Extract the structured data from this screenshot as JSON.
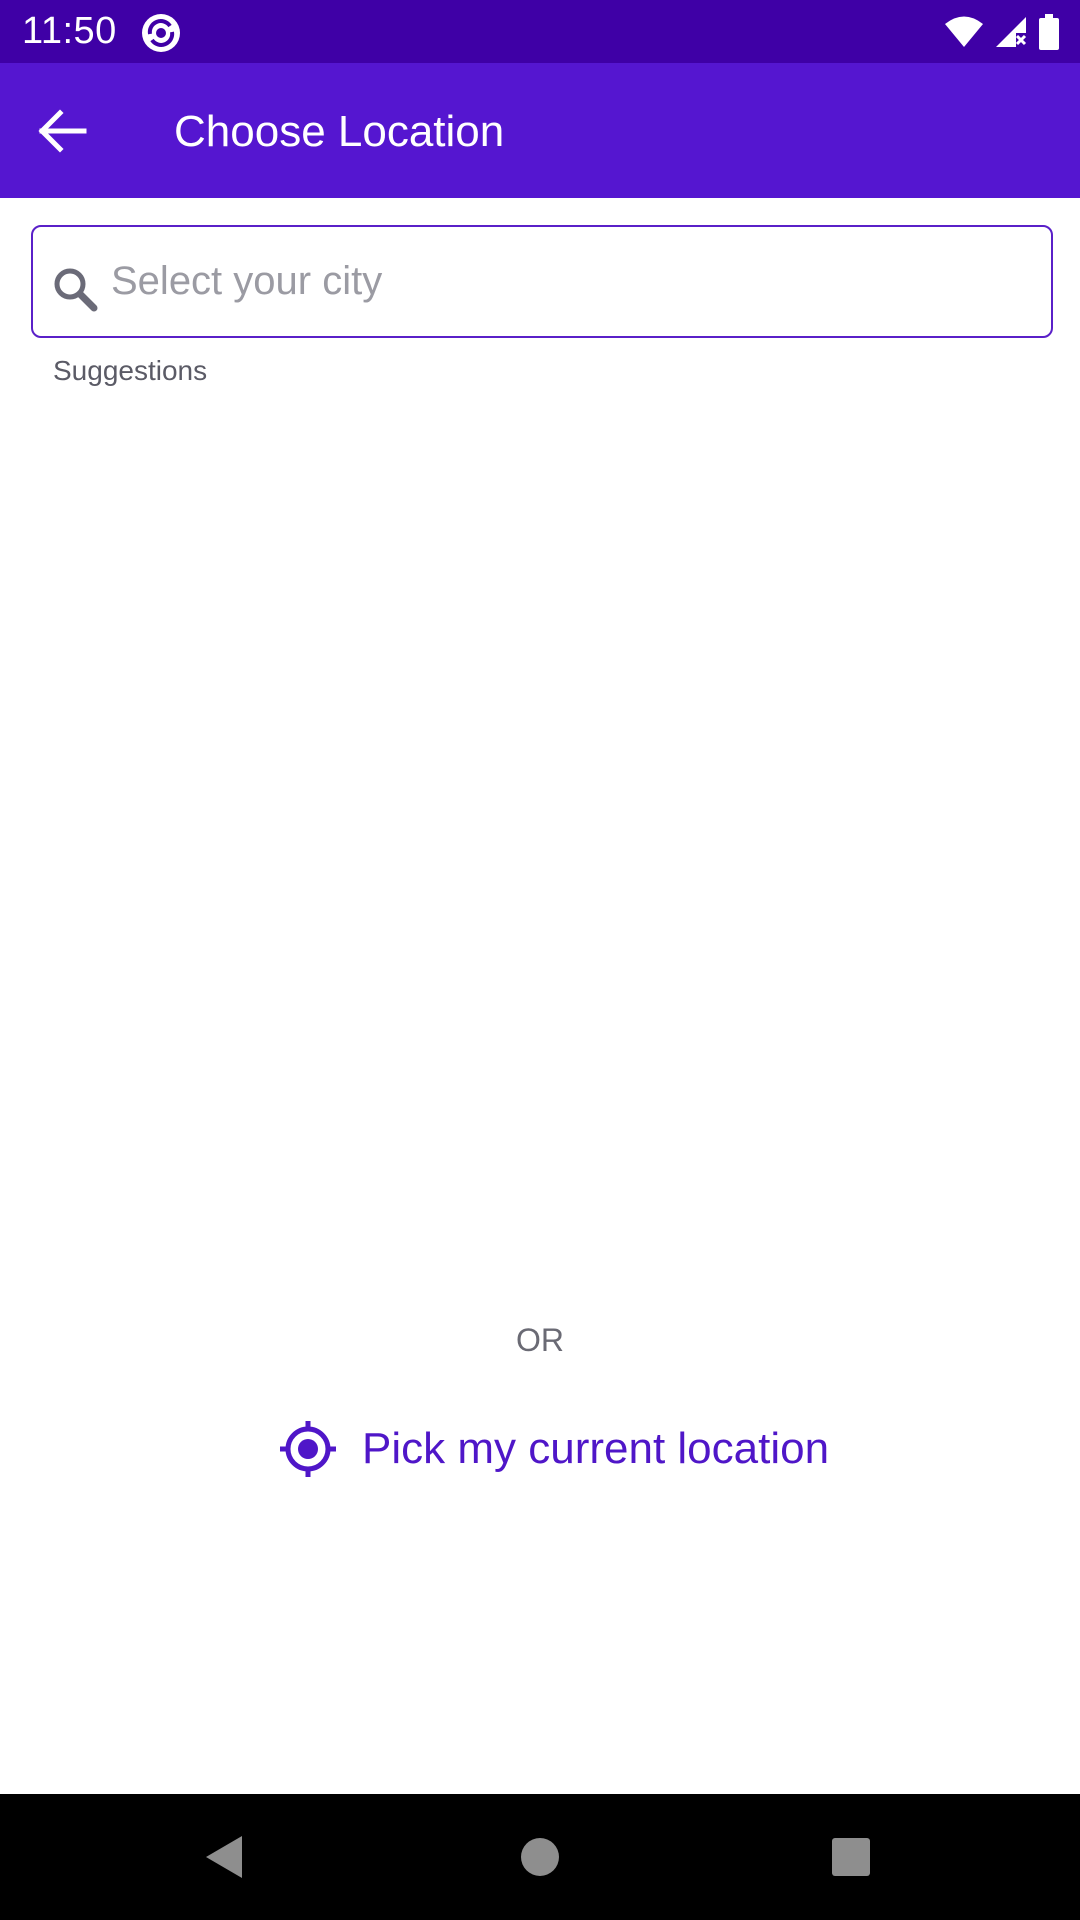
{
  "status_bar": {
    "time": "11:50",
    "icons": [
      "sync-app-icon",
      "wifi-icon",
      "cellular-no-data-icon",
      "battery-icon"
    ]
  },
  "app_bar": {
    "back_icon": "arrow-left-icon",
    "title": "Choose Location"
  },
  "search": {
    "icon": "search-icon",
    "placeholder": "Select your city",
    "value": ""
  },
  "suggestions": {
    "label": "Suggestions",
    "items": []
  },
  "divider_text": "OR",
  "current_location": {
    "icon": "gps-target-icon",
    "label": "Pick my current location"
  },
  "nav_bar": {
    "buttons": [
      "back-triangle-icon",
      "home-circle-icon",
      "recents-square-icon"
    ]
  },
  "colors": {
    "status_bar": "#3f00a6",
    "app_bar": "#5516d0",
    "accent": "#4f16c8",
    "search_border": "#5a20c8",
    "nav_bar": "#000000"
  }
}
